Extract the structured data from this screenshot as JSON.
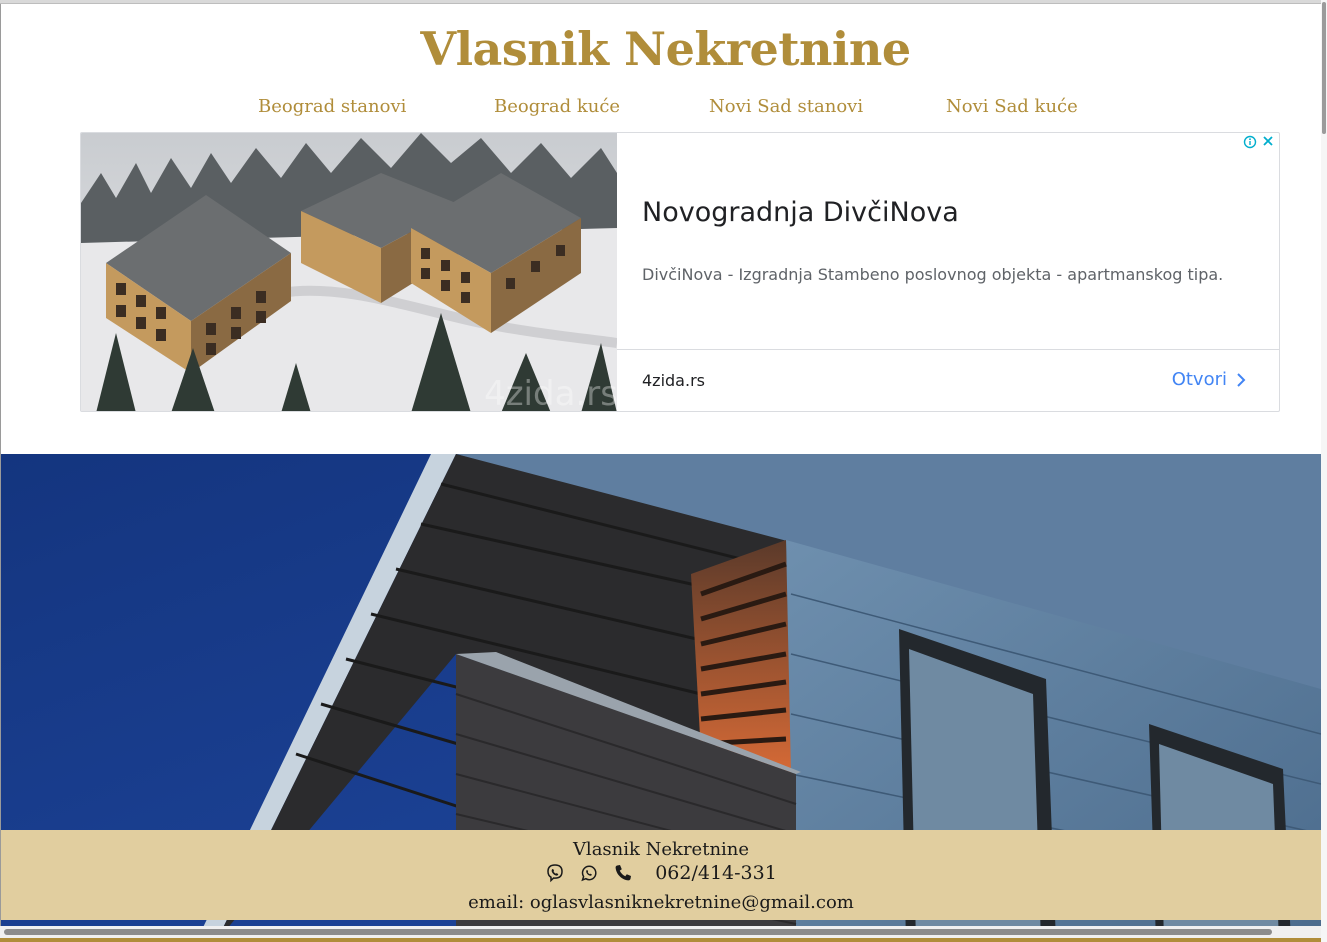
{
  "site": {
    "title": "Vlasnik Nekretnine"
  },
  "nav": {
    "items": [
      {
        "label": "Beograd stanovi"
      },
      {
        "label": "Beograd kuće"
      },
      {
        "label": "Novi Sad stanovi"
      },
      {
        "label": "Novi Sad kuće"
      }
    ]
  },
  "ad": {
    "headline": "Novogradnja DivčiNova",
    "description": "DivčiNova - Izgradnja Stambeno poslovnog objekta - apartmanskog tipa.",
    "domain": "4zida.rs",
    "cta": "Otvori",
    "image_watermark": "4zida.rs",
    "accent_color": "#4285f4"
  },
  "footer": {
    "title": "Vlasnik Nekretnine",
    "phone": "062/414-331",
    "email": "email: oglasvlasniknekretnine@gmail.com",
    "icons": [
      "viber-icon",
      "whatsapp-icon",
      "phone-icon"
    ],
    "background": "#e1ce9f"
  },
  "theme": {
    "brand_color": "#b08d3a"
  }
}
